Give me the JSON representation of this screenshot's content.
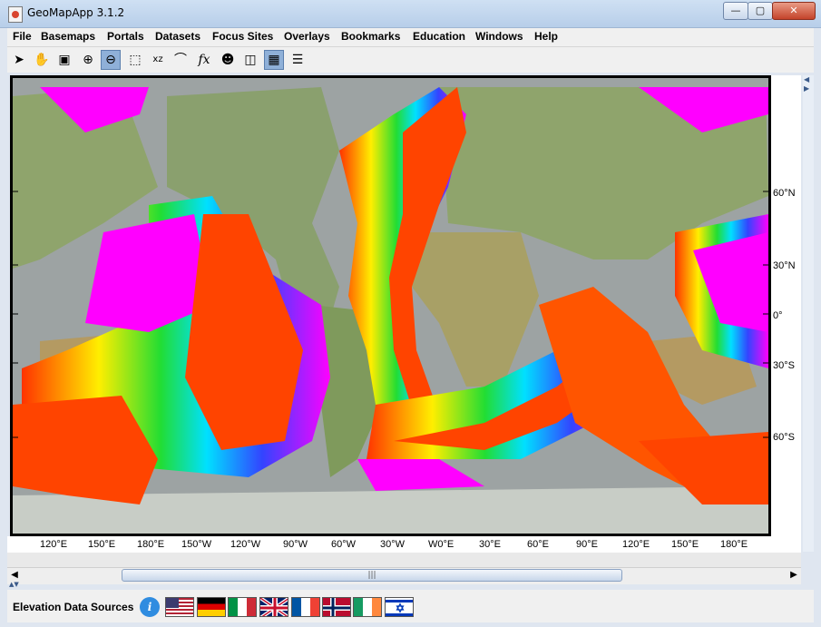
{
  "window": {
    "title": "GeoMapApp 3.1.2"
  },
  "menu": [
    "File",
    "Basemaps",
    "Portals",
    "Datasets",
    "Focus Sites",
    "Overlays",
    "Bookmarks",
    "Education",
    "Windows",
    "Help"
  ],
  "toolbar": {
    "tools": [
      {
        "name": "select-arrow-icon",
        "glyph": "➤"
      },
      {
        "name": "pan-hand-icon",
        "glyph": "✋"
      },
      {
        "name": "save-disk-icon",
        "glyph": "💾"
      },
      {
        "name": "zoom-in-icon",
        "glyph": "⊕"
      },
      {
        "name": "zoom-out-icon",
        "glyph": "⊖"
      },
      {
        "name": "rectangle-select-icon",
        "glyph": "⬚"
      },
      {
        "name": "xyz-icon",
        "glyph": "xz"
      },
      {
        "name": "lasso-icon",
        "glyph": "⌒"
      },
      {
        "name": "function-icon",
        "glyph": "fx"
      },
      {
        "name": "mask-icon",
        "glyph": "☻"
      },
      {
        "name": "layer-icon",
        "glyph": "◫"
      },
      {
        "name": "grid-icon",
        "glyph": "▦"
      },
      {
        "name": "list-icon",
        "glyph": "☰"
      }
    ]
  },
  "map": {
    "x_ticks": [
      "120°E",
      "150°E",
      "180°E",
      "150°W",
      "120°W",
      "90°W",
      "60°W",
      "30°W",
      "W0°E",
      "30°E",
      "60°E",
      "90°E",
      "120°E",
      "150°E",
      "180°E"
    ],
    "y_ticks": [
      "60°N",
      "30°N",
      "0°",
      "30°S",
      "60°S"
    ]
  },
  "status": {
    "label": "Elevation Data Sources",
    "info_glyph": "i",
    "flags": [
      "usa-flag",
      "germany-flag",
      "italy-flag",
      "uk-flag",
      "france-flag",
      "norway-flag",
      "ireland-flag",
      "israel-flag"
    ]
  },
  "colors": {
    "accent": "#2f8ce0",
    "scroll_thumb": "#c7d6ea"
  }
}
